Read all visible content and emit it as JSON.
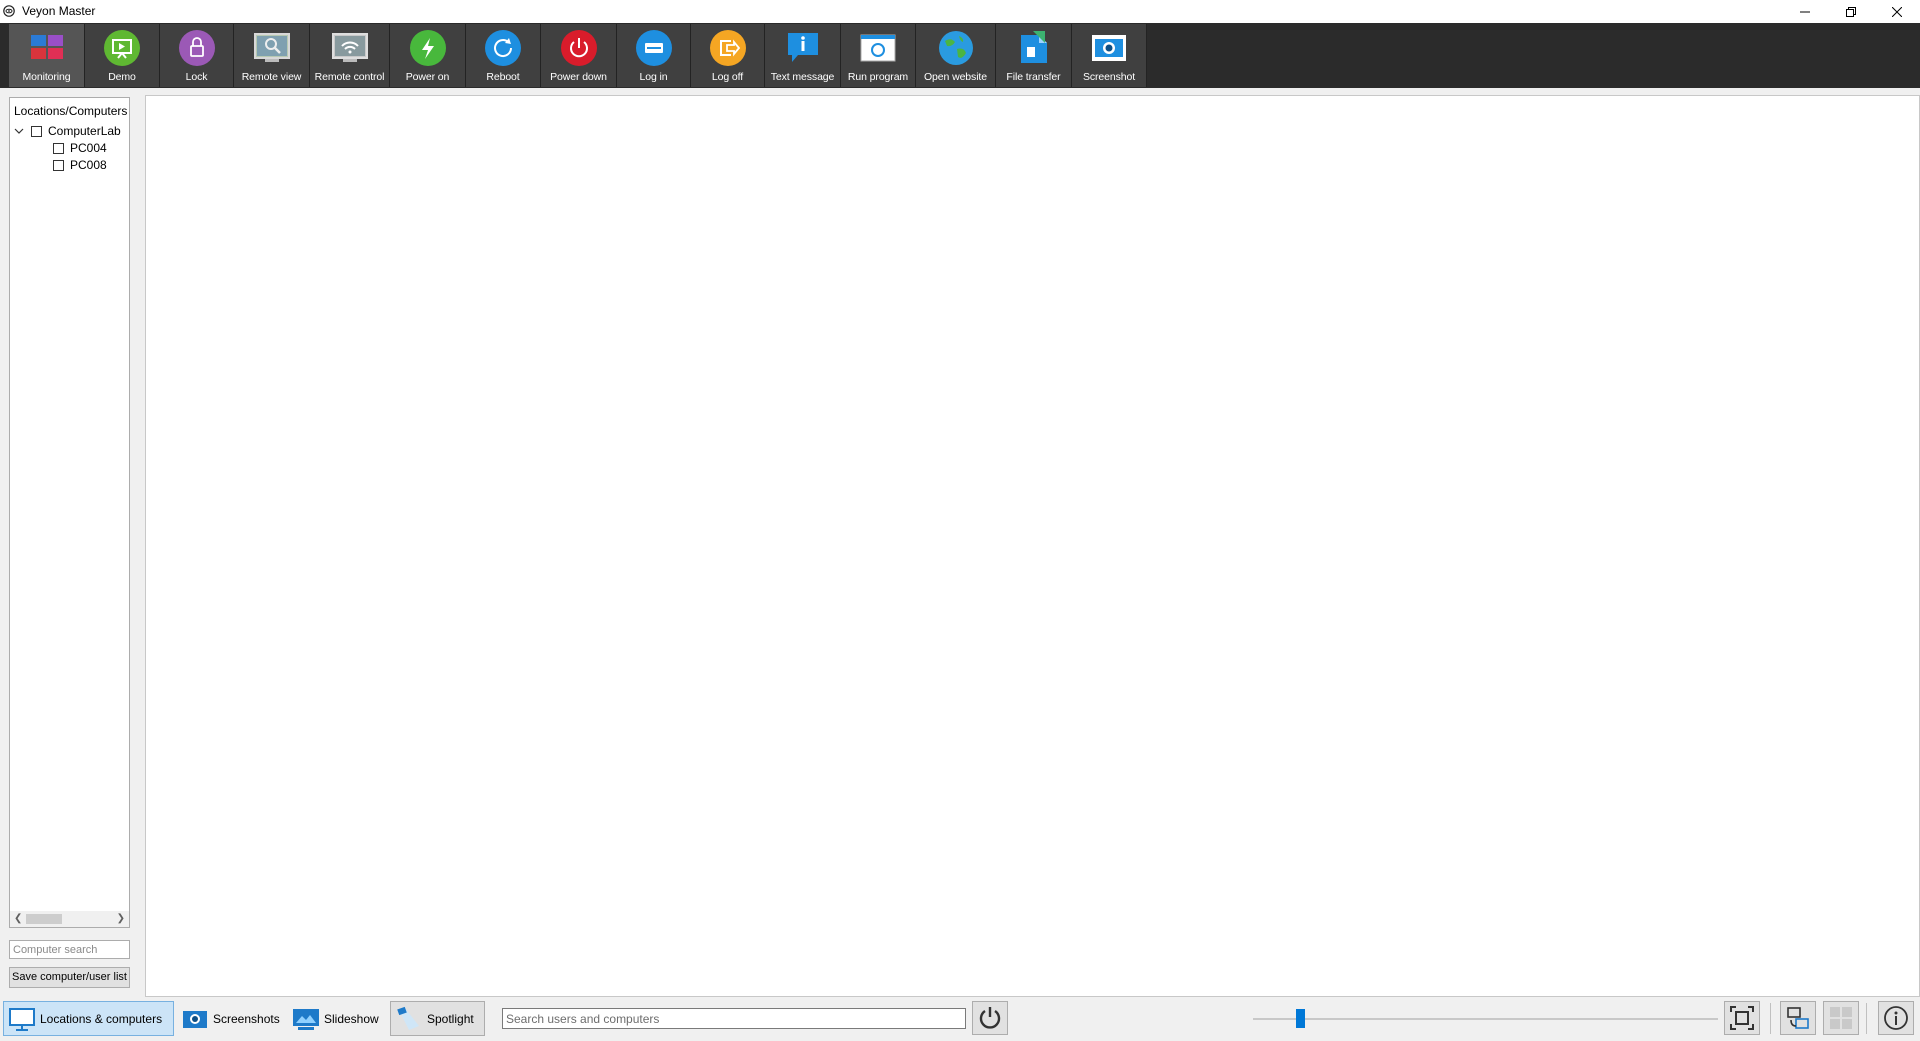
{
  "window": {
    "title": "Veyon Master"
  },
  "toolbar": {
    "items": [
      {
        "label": "Monitoring",
        "icon": "monitoring-icon",
        "active": true
      },
      {
        "label": "Demo",
        "icon": "demo-icon"
      },
      {
        "label": "Lock",
        "icon": "lock-icon"
      },
      {
        "label": "Remote view",
        "icon": "remote-view-icon"
      },
      {
        "label": "Remote control",
        "icon": "remote-control-icon"
      },
      {
        "label": "Power on",
        "icon": "power-on-icon"
      },
      {
        "label": "Reboot",
        "icon": "reboot-icon"
      },
      {
        "label": "Power down",
        "icon": "power-down-icon"
      },
      {
        "label": "Log in",
        "icon": "log-in-icon"
      },
      {
        "label": "Log off",
        "icon": "log-off-icon"
      },
      {
        "label": "Text message",
        "icon": "text-message-icon"
      },
      {
        "label": "Run program",
        "icon": "run-program-icon"
      },
      {
        "label": "Open website",
        "icon": "open-website-icon"
      },
      {
        "label": "File transfer",
        "icon": "file-transfer-icon"
      },
      {
        "label": "Screenshot",
        "icon": "screenshot-icon"
      }
    ]
  },
  "locations": {
    "header": "Locations/Computers",
    "root": {
      "label": "ComputerLab",
      "expanded": true,
      "checked": false
    },
    "computers": [
      {
        "label": "PC004",
        "checked": false
      },
      {
        "label": "PC008",
        "checked": false
      }
    ]
  },
  "computer_search": {
    "placeholder": "Computer search",
    "value": ""
  },
  "save_list_label": "Save computer/user list",
  "bottombar": {
    "locations_label": "Locations & computers",
    "screenshots_label": "Screenshots",
    "slideshow_label": "Slideshow",
    "spotlight_label": "Spotlight",
    "search": {
      "placeholder": "Search users and computers",
      "value": ""
    },
    "zoom_level": 0.1
  },
  "colors": {
    "toolbar_bg": "#2b2b2b",
    "tool_bg": "#404040",
    "active_tab_bg": "#cce4f7",
    "accent": "#0078d7"
  }
}
